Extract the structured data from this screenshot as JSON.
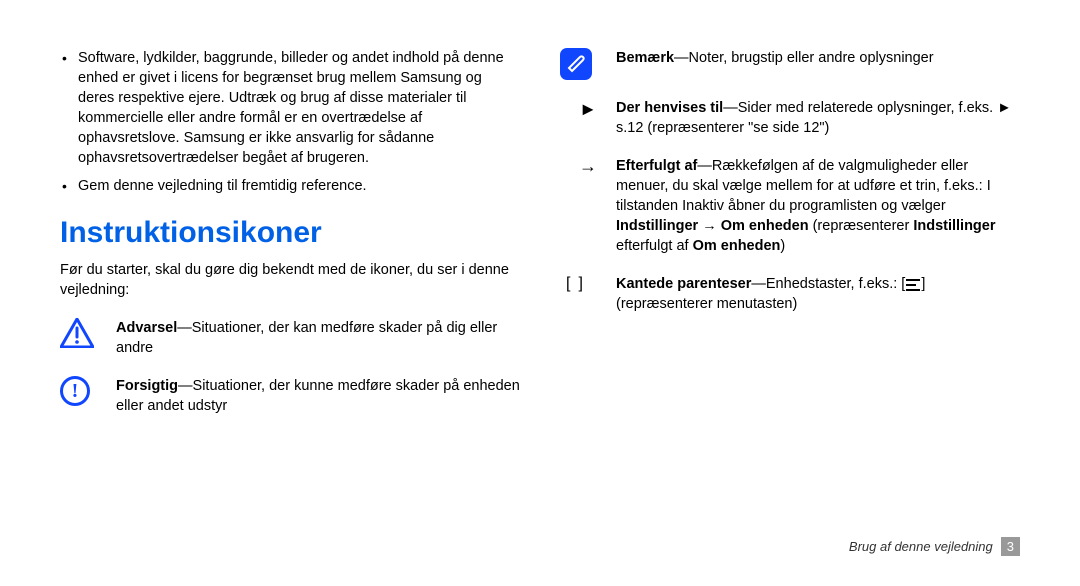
{
  "left": {
    "bullets": [
      "Software, lydkilder, baggrunde, billeder og andet indhold på denne enhed er givet i licens for begrænset brug mellem Samsung og deres respektive ejere. Udtræk og brug af disse materialer til kommercielle eller andre formål er en overtrædelse af ophavsretslove. Samsung er ikke ansvarlig for sådanne ophavsretsovertrædelser begået af brugeren.",
      "Gem denne vejledning til fremtidig reference."
    ],
    "section_title": "Instruktionsikoner",
    "intro": "Før du starter, skal du gøre dig bekendt med de ikoner, du ser i denne vejledning:",
    "warning_label": "Advarsel",
    "warning_text": "—Situationer, der kan medføre skader på dig eller andre",
    "caution_label": "Forsigtig",
    "caution_text": "—Situationer, der kunne medføre skader på enheden eller andet udstyr"
  },
  "right": {
    "note_label": "Bemærk",
    "note_text": "—Noter, brugstip eller andre oplysninger",
    "ref_symbol": "►",
    "ref_label": "Der henvises til",
    "ref_text": "—Sider med relaterede oplysninger, f.eks. ► s.12 (repræsenterer \"se side 12\")",
    "arrow_symbol": "→",
    "followed_label": "Efterfulgt af",
    "followed_text_1": "—Rækkefølgen af de valgmuligheder eller menuer, du skal vælge mellem for at udføre et trin, f.eks.: I tilstanden Inaktiv åbner du programlisten og vælger ",
    "followed_bold_1": "Indstillinger → Om enheden",
    "followed_text_2": " (repræsenterer ",
    "followed_bold_2": "Indstillinger",
    "followed_text_3": " efterfulgt af ",
    "followed_bold_3": "Om enheden",
    "followed_text_4": ")",
    "bracket_left": "[",
    "bracket_right": "]",
    "bracket_label": "Kantede parenteser",
    "bracket_text_1": "—Enhedstaster, f.eks.: [",
    "bracket_text_2": "] (repræsenterer menutasten)"
  },
  "footer": {
    "section": "Brug af denne vejledning",
    "page": "3"
  }
}
